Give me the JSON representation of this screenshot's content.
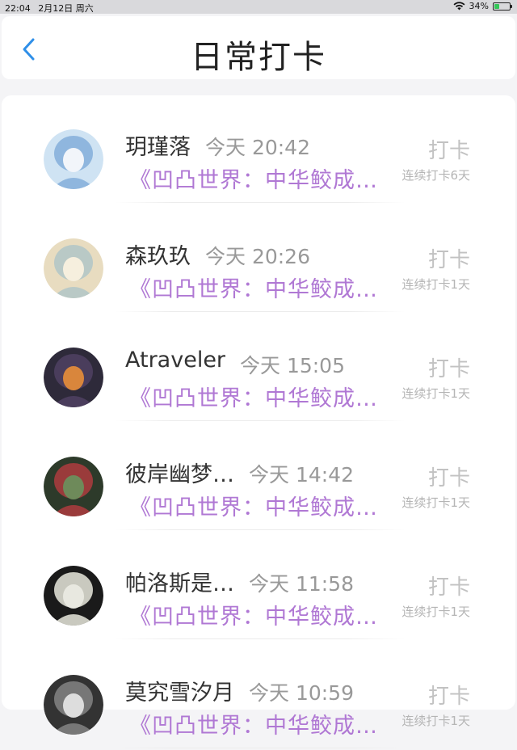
{
  "status_bar": {
    "time": "22:04",
    "date": "2月12日 周六",
    "battery": "34%",
    "battery_level": 0.34
  },
  "header": {
    "title": "日常打卡"
  },
  "entries": [
    {
      "name": "玥瑾落",
      "time": "今天 20:42",
      "topic": "《凹凸世界：中华鲛成…",
      "action": "打卡",
      "streak": "连续打卡6天",
      "avatar_colors": [
        "#cfe3f3",
        "#f2f5fa",
        "#8fb6de"
      ]
    },
    {
      "name": "森玖玖",
      "time": "今天 20:26",
      "topic": "《凹凸世界：中华鲛成…",
      "action": "打卡",
      "streak": "连续打卡1天",
      "avatar_colors": [
        "#e8dcc0",
        "#f6efde",
        "#b9c9c6"
      ]
    },
    {
      "name": "Atraveler",
      "time": "今天 15:05",
      "topic": "《凹凸世界：中华鲛成…",
      "action": "打卡",
      "streak": "连续打卡1天",
      "avatar_colors": [
        "#2e2a3a",
        "#d9863c",
        "#4a3d5c"
      ]
    },
    {
      "name": "彼岸幽梦…",
      "time": "今天 14:42",
      "topic": "《凹凸世界：中华鲛成…",
      "action": "打卡",
      "streak": "连续打卡1天",
      "avatar_colors": [
        "#2d3a2a",
        "#6e8a5a",
        "#9a3b3b"
      ]
    },
    {
      "name": "帕洛斯是…",
      "time": "今天 11:58",
      "topic": "《凹凸世界：中华鲛成…",
      "action": "打卡",
      "streak": "连续打卡1天",
      "avatar_colors": [
        "#1a1a1a",
        "#e8e8e0",
        "#c9c9bf"
      ]
    },
    {
      "name": "莫究雪汐月",
      "time": "今天 10:59",
      "topic": "《凹凸世界：中华鲛成…",
      "action": "打卡",
      "streak": "连续打卡1天",
      "avatar_colors": [
        "#333333",
        "#dddddd",
        "#777777"
      ]
    }
  ]
}
